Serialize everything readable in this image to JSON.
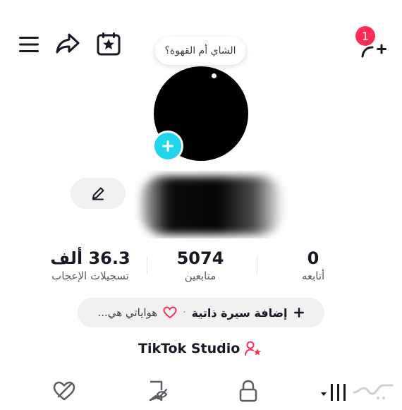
{
  "topbar": {
    "menu_icon": "hamburger-icon",
    "share_icon": "share-arrow-icon",
    "calendar_icon": "calendar-star-icon",
    "add_friend_icon": "add-user-icon",
    "notification_count": "1"
  },
  "profile": {
    "note_bubble": "الشاي أم القهوة؟",
    "add_photo_icon": "plus-icon",
    "edit_icon": "pencil-icon"
  },
  "stats": {
    "likes_value": "36.3 ألف",
    "likes_label": "تسجيلات الإعجاب",
    "followers_value": "5074",
    "followers_label": "متابعين",
    "following_value": "0",
    "following_label": "أتابعه"
  },
  "bio_row": {
    "add_bio_label": "إضافة سيرة ذاتية",
    "separator": "·",
    "hobbies_label": "هواياتي هي..."
  },
  "studio": {
    "label": "TikTok Studio",
    "icon": "user-star-icon"
  },
  "tabs": {
    "favorites_icon": "heart-eye-slash-icon",
    "saved_icon": "bookmark-eye-slash-icon",
    "private_icon": "lock-icon",
    "videos_icon": "grid-lines-icon"
  },
  "colors": {
    "accent_pink": "#fe2c55",
    "add_blue": "#20d5ec",
    "text": "#161823",
    "muted": "#5a5c66",
    "chip_bg": "#f1f1f2"
  }
}
